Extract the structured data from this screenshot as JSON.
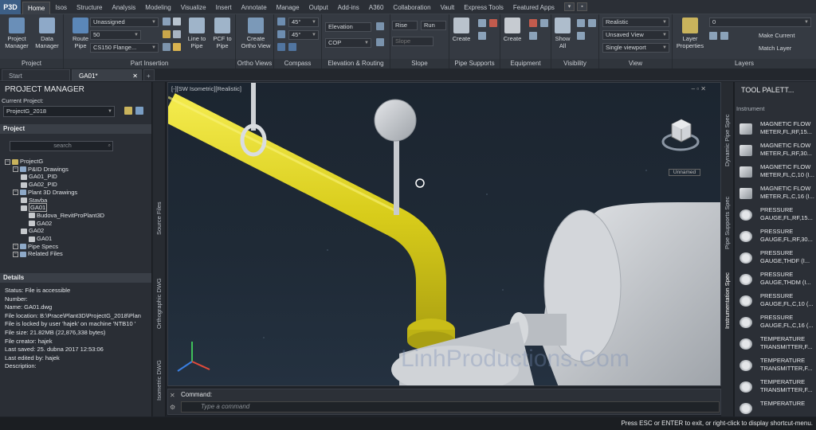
{
  "app": {
    "button_label": "P3D"
  },
  "menu_tabs": [
    "Home",
    "Isos",
    "Structure",
    "Analysis",
    "Modeling",
    "Visualize",
    "Insert",
    "Annotate",
    "Manage",
    "Output",
    "Add-ins",
    "A360",
    "Collaboration",
    "Vault",
    "Express Tools",
    "Featured Apps"
  ],
  "ribbon": {
    "project": {
      "label": "Project",
      "btn1": "Project\nManager",
      "btn2": "Data\nManager"
    },
    "part_insertion": {
      "label": "Part Insertion",
      "route_pipe": "Route\nPipe",
      "spec_combo": "Unassigned",
      "size_combo": "50",
      "flange_combo": "CS150 Flange...",
      "line_to_pipe": "Line to\nPipe",
      "pcf_to_pipe": "PCF to\nPipe"
    },
    "ortho_views": {
      "label": "Ortho Views",
      "create": "Create\nOrtho View"
    },
    "compass": {
      "label": "Compass",
      "angle1": "45°",
      "angle2": "45°"
    },
    "elevation": {
      "label": "Elevation & Routing",
      "elevation_field": "Elevation",
      "cop_combo": "COP"
    },
    "slope": {
      "label": "Slope",
      "rise": "Rise",
      "run": "Run",
      "slope": "Slope"
    },
    "pipe_supports": {
      "label": "Pipe Supports",
      "create": "Create"
    },
    "equipment": {
      "label": "Equipment",
      "create": "Create"
    },
    "visibility": {
      "label": "Visibility",
      "show_all": "Show\nAll"
    },
    "view": {
      "label": "View",
      "visual_style": "Realistic",
      "named_view": "Unsaved View",
      "viewport": "Single viewport"
    },
    "layers": {
      "label": "Layers",
      "layer_properties": "Layer\nProperties",
      "layer_combo": "0",
      "make_current": "Make Current",
      "match_layer": "Match Layer"
    }
  },
  "doc_tabs": [
    "Start",
    "GA01*"
  ],
  "project_manager": {
    "title": "PROJECT MANAGER",
    "current_project_label": "Current Project:",
    "current_project_value": "ProjectG_2018",
    "project_header": "Project",
    "search_placeholder": "search",
    "tree": [
      {
        "label": "ProjectG",
        "level": 0
      },
      {
        "label": "P&ID Drawings",
        "level": 1
      },
      {
        "label": "GA01_PID",
        "level": 2
      },
      {
        "label": "GA02_PID",
        "level": 2
      },
      {
        "label": "Plant 3D Drawings",
        "level": 1
      },
      {
        "label": "Stavba",
        "level": 2
      },
      {
        "label": "GA01",
        "level": 2
      },
      {
        "label": "Budova_RevitProPlant3D",
        "level": 3
      },
      {
        "label": "GA02",
        "level": 3
      },
      {
        "label": "GA02",
        "level": 2
      },
      {
        "label": "GA01",
        "level": 3
      },
      {
        "label": "Pipe Specs",
        "level": 1
      },
      {
        "label": "Related Files",
        "level": 1
      }
    ],
    "details_header": "Details",
    "details": [
      "Status: File is accessible",
      "Number:",
      "Name: GA01.dwg",
      "File location: B:\\Prace\\Plant3D\\ProjectG_2018\\Plan",
      "File is locked by user 'hajek' on machine 'NTB10 '",
      "File size: 21.82MB (22,876,338 bytes)",
      "File creator: hajek",
      "Last saved: 25. dubna 2017 12:53:06",
      "Last edited by: hajek",
      "Description:"
    ]
  },
  "side_strips": {
    "left_top": "Source Files",
    "left_mid": "Orthographic DWG",
    "left_bot": "Isometric DWG",
    "right_1": "Dynamic Pipe Spec",
    "right_2": "Pipe Supports Spec",
    "right_3": "Instrumentation Spec"
  },
  "viewport": {
    "label": "[-][SW Isometric][Realistic]",
    "viewcube_label": "Unnamed",
    "watermark": "LinhProductions.Com"
  },
  "command": {
    "label": "Command:",
    "placeholder": "Type a command"
  },
  "tool_palette": {
    "title": "TOOL PALETT...",
    "section": "Instrument",
    "items": [
      "MAGNETIC FLOW METER,FL,RF,15...",
      "MAGNETIC FLOW METER,FL,RF,30...",
      "MAGNETIC FLOW METER,FL,C,10 (I...",
      "MAGNETIC FLOW METER,FL,C,16 (I...",
      "PRESSURE GAUGE,FL,RF,15...",
      "PRESSURE GAUGE,FL,RF,30...",
      "PRESSURE GAUGE,THDF (I...",
      "PRESSURE GAUGE,THDM (I...",
      "PRESSURE GAUGE,FL,C,10 (...",
      "PRESSURE GAUGE,FL,C,16 (...",
      "TEMPERATURE TRANSMITTER,F...",
      "TEMPERATURE TRANSMITTER,F...",
      "TEMPERATURE TRANSMITTER,F...",
      "TEMPERATURE"
    ]
  },
  "status_bar": "Press ESC or ENTER to exit, or right-click to display shortcut-menu.",
  "colors": {
    "pipe": "#e6d82a",
    "equipment": "#c9ccd0",
    "accent": "#3d5f86"
  }
}
